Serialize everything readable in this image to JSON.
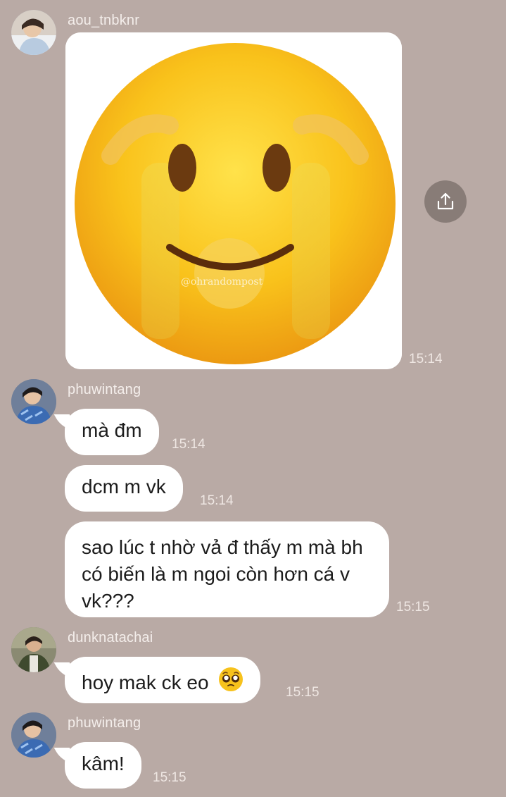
{
  "messages": [
    {
      "sender": "aou_tnbknr",
      "type": "image",
      "watermark": "@ohrandompost",
      "time": "15:14"
    },
    {
      "sender": "phuwintang",
      "text": "mà đm",
      "time": "15:14"
    },
    {
      "text": "dcm m vk",
      "time": "15:14"
    },
    {
      "text": "sao lúc t nhờ vả đ thấy m mà bh có biến là m ngoi còn hơn cá v vk???",
      "time": "15:15"
    },
    {
      "sender": "dunknatachai",
      "text": "hoy mak ck eo",
      "emoji": "pleading-face",
      "time": "15:15"
    },
    {
      "sender": "phuwintang",
      "text": "kâm!",
      "time": "15:15"
    }
  ],
  "icons": {
    "share": "share-upload-icon"
  },
  "colors": {
    "background": "#b9aaa5",
    "bubble": "#ffffff",
    "emoji_yellow": "#f7c21c"
  }
}
